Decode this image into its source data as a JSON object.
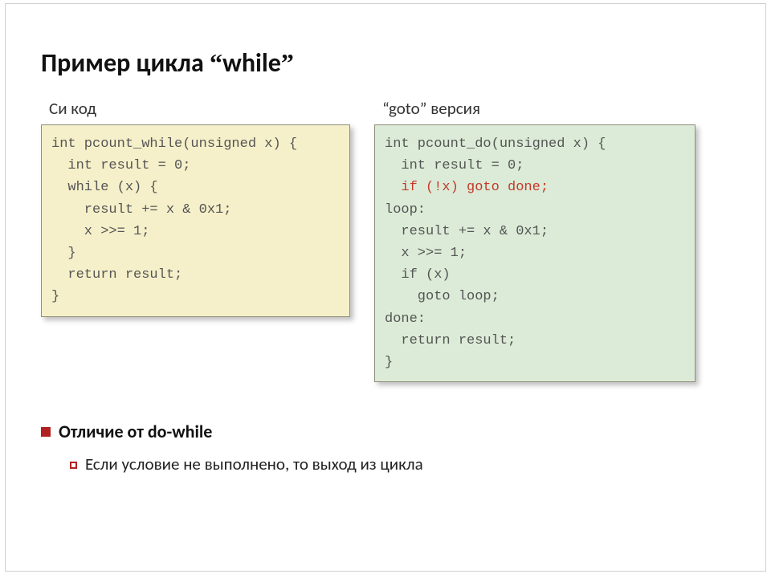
{
  "title_prefix": "Пример цикла ",
  "title_quoted": "while",
  "left": {
    "heading": "Си код",
    "code": "int pcount_while(unsigned x) {\n  int result = 0;\n  while (x) {\n    result += x & 0x1;\n    x >>= 1;\n  }\n  return result;\n}"
  },
  "right": {
    "heading_prefix": "",
    "heading_quoted": "goto",
    "heading_suffix": " версия",
    "code_before_red": "int pcount_do(unsigned x) {\n  int result = 0;\n",
    "code_red": "  if (!x) goto done;",
    "code_after_red": "\nloop:\n  result += x & 0x1;\n  x >>= 1;\n  if (x)\n    goto loop;\ndone:\n  return result;\n}"
  },
  "difference_heading": "Отличие от do-while",
  "difference_point": "Если условие не выполнено, то выход из цикла"
}
